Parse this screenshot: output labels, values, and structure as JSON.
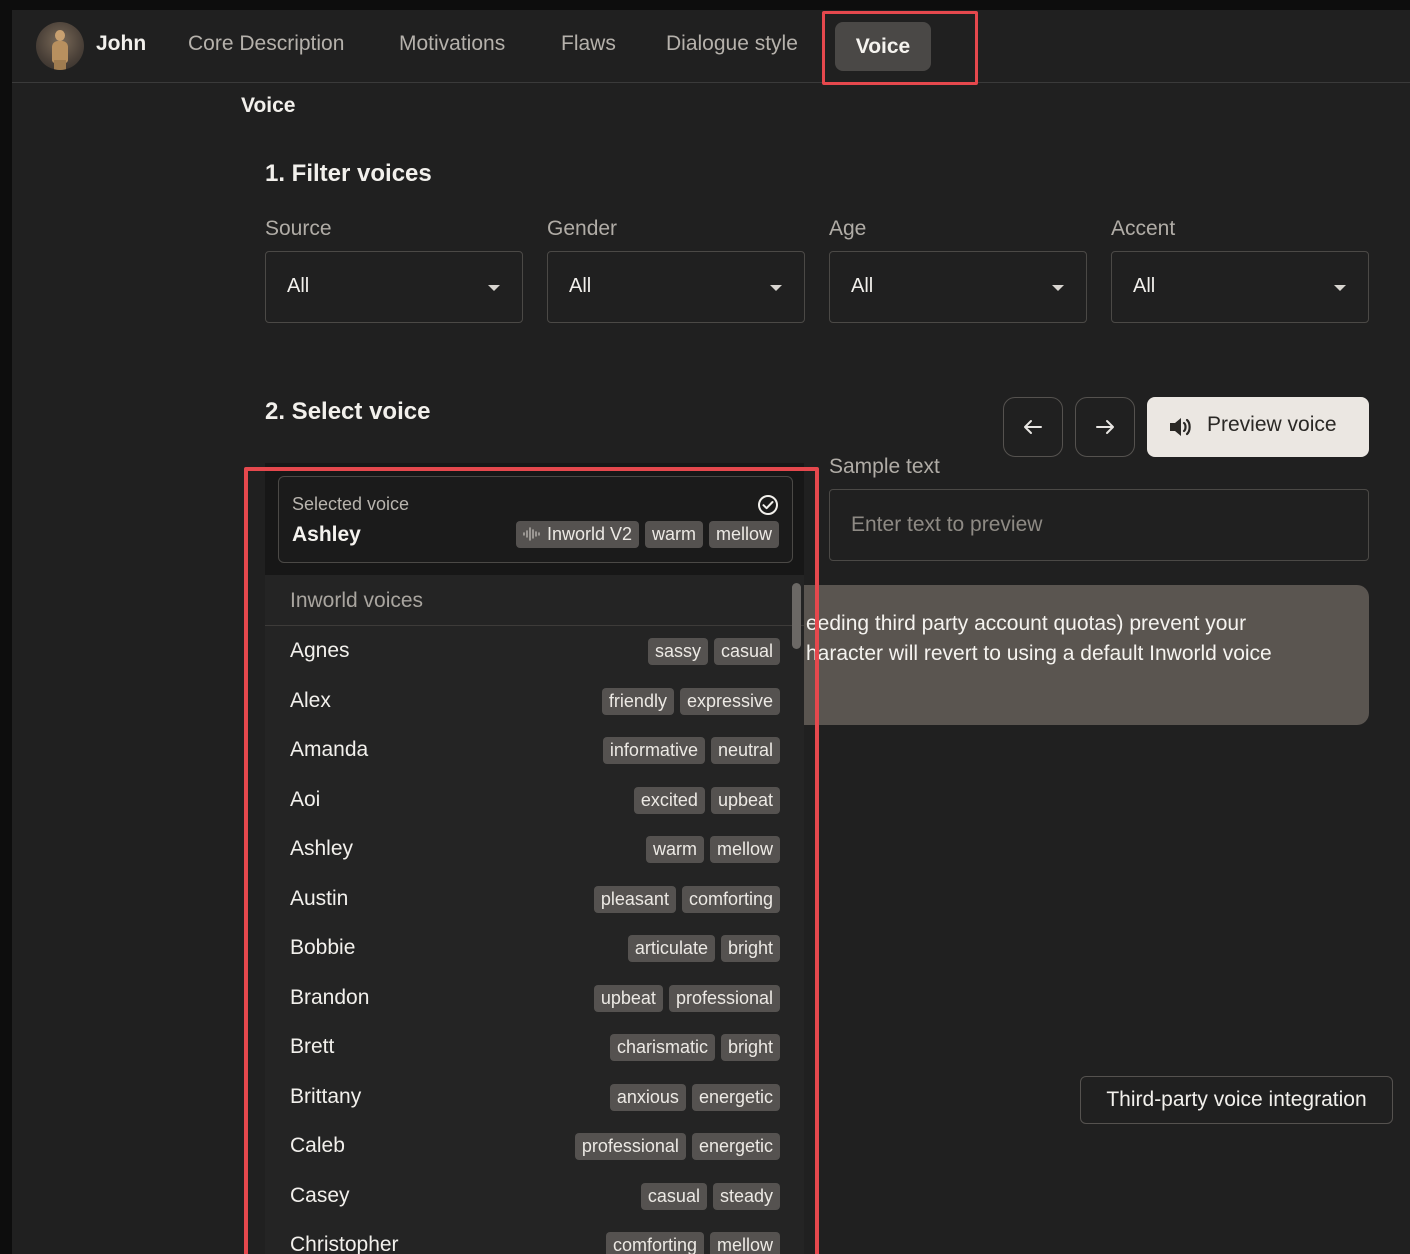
{
  "character": {
    "name": "John"
  },
  "nav": {
    "tabs": [
      "Core Description",
      "Motivations",
      "Flaws",
      "Dialogue style"
    ],
    "active_tab": "Voice"
  },
  "section_title": "Voice",
  "filter": {
    "heading": "1. Filter voices",
    "fields": [
      {
        "label": "Source",
        "value": "All"
      },
      {
        "label": "Gender",
        "value": "All"
      },
      {
        "label": "Age",
        "value": "All"
      },
      {
        "label": "Accent",
        "value": "All"
      }
    ]
  },
  "select": {
    "heading": "2. Select voice",
    "preview_label": "Preview voice",
    "sample_label": "Sample text",
    "sample_placeholder": "Enter text to preview",
    "notice_line1": "eeding third party account quotas) prevent your",
    "notice_line2": "haracter will revert to using a default Inworld voice",
    "third_party_label": "Third-party voice integration"
  },
  "selected_voice": {
    "label": "Selected voice",
    "name": "Ashley",
    "model": "Inworld V2",
    "tags": [
      "warm",
      "mellow"
    ]
  },
  "voice_group": "Inworld voices",
  "voices": [
    {
      "name": "Agnes",
      "tags": [
        "sassy",
        "casual"
      ]
    },
    {
      "name": "Alex",
      "tags": [
        "friendly",
        "expressive"
      ]
    },
    {
      "name": "Amanda",
      "tags": [
        "informative",
        "neutral"
      ]
    },
    {
      "name": "Aoi",
      "tags": [
        "excited",
        "upbeat"
      ]
    },
    {
      "name": "Ashley",
      "tags": [
        "warm",
        "mellow"
      ]
    },
    {
      "name": "Austin",
      "tags": [
        "pleasant",
        "comforting"
      ]
    },
    {
      "name": "Bobbie",
      "tags": [
        "articulate",
        "bright"
      ]
    },
    {
      "name": "Brandon",
      "tags": [
        "upbeat",
        "professional"
      ]
    },
    {
      "name": "Brett",
      "tags": [
        "charismatic",
        "bright"
      ]
    },
    {
      "name": "Brittany",
      "tags": [
        "anxious",
        "energetic"
      ]
    },
    {
      "name": "Caleb",
      "tags": [
        "professional",
        "energetic"
      ]
    },
    {
      "name": "Casey",
      "tags": [
        "casual",
        "steady"
      ]
    },
    {
      "name": "Christopher",
      "tags": [
        "comforting",
        "mellow"
      ]
    }
  ],
  "icons": {
    "prev": "arrow-left-icon",
    "next": "arrow-right-icon",
    "preview": "speaker-icon",
    "selected": "check-circle-icon",
    "model": "waveform-icon",
    "filter": "caret-down-icon"
  },
  "colors": {
    "highlight": "#e5484d",
    "active_tab": "#4a4846",
    "preview_bg": "#ebe7e2"
  }
}
